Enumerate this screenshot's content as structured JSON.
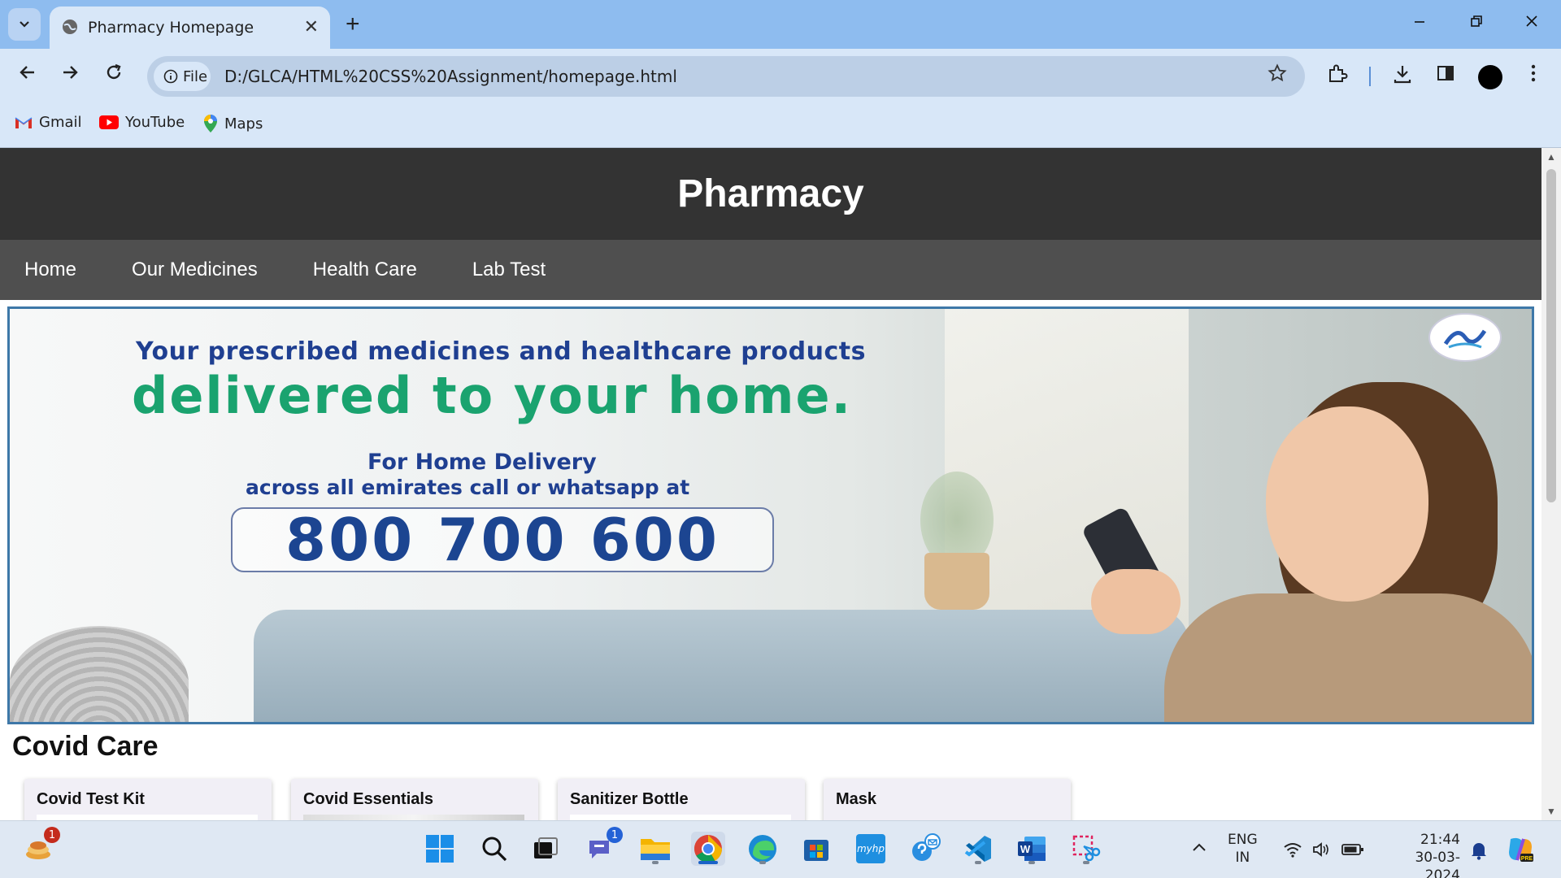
{
  "browser": {
    "tab_title": "Pharmacy Homepage",
    "tab_close": "✕",
    "new_tab": "+",
    "file_label": "File",
    "url": "D:/GLCA/HTML%20CSS%20Assignment/homepage.html",
    "bookmarks": [
      {
        "label": "Gmail",
        "icon": "gmail-icon"
      },
      {
        "label": "YouTube",
        "icon": "youtube-icon"
      },
      {
        "label": "Maps",
        "icon": "maps-icon"
      }
    ]
  },
  "page": {
    "site_title": "Pharmacy",
    "nav": [
      "Home",
      "Our Medicines",
      "Health Care",
      "Lab Test"
    ],
    "banner": {
      "line1": "Your prescribed medicines and healthcare products",
      "line2": "delivered to your home.",
      "line3": "For Home Delivery",
      "line4": "across all emirates call or whatsapp at",
      "phone": "800 700 600"
    },
    "section_title": "Covid Care",
    "products": [
      "Covid Test Kit",
      "Covid Essentials",
      "Sanitizer Bottle",
      "Mask"
    ]
  },
  "taskbar": {
    "widgets_badge": "1",
    "teams_badge": "1",
    "language_line1": "ENG",
    "language_line2": "IN",
    "time": "21:44",
    "date": "30-03-2024",
    "myhp_label": "myhp"
  },
  "colors": {
    "header_bg": "#333333",
    "nav_bg": "#4f4f4f",
    "banner_green": "#1aa36f",
    "banner_blue": "#1f3f91",
    "chrome_blue": "#8ebcef"
  }
}
